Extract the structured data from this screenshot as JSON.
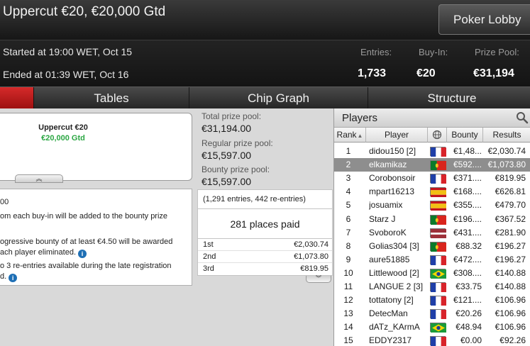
{
  "title": "Uppercut €20, €20,000 Gtd",
  "lobby_button": "Poker Lobby",
  "started": "Started at 19:00 WET, Oct 15",
  "ended": "Ended at 01:39 WET, Oct 16",
  "stats": {
    "entries_label": "Entries:",
    "entries_value": "1,733",
    "buyin_label": "Buy-In:",
    "buyin_value": "€20",
    "prizepool_label": "Prize Pool:",
    "prizepool_value": "€31,194"
  },
  "tabs": [
    "Tables",
    "Chip Graph",
    "Structure"
  ],
  "card": {
    "name": "Uppercut €20",
    "gtd": "€20,000 Gtd",
    "collapse": "︽"
  },
  "description": [
    "00",
    "om each buy-in will be added to the bounty prize",
    "",
    "ogressive bounty of at least €4.50 will be awarded",
    "ach player eliminated.",
    "o 3 re-entries available during the late registration",
    "d."
  ],
  "prize": {
    "total_label": "Total prize pool:",
    "total_value": "€31,194.00",
    "regular_label": "Regular prize pool:",
    "regular_value": "€15,597.00",
    "bounty_label": "Bounty prize pool:",
    "bounty_value": "€15,597.00",
    "entries_note": "(1,291 entries, 442 re-entries)",
    "places_paid": "281 places paid",
    "rows": [
      {
        "place": "1st",
        "amount": "€2,030.74"
      },
      {
        "place": "2nd",
        "amount": "€1,073.80"
      },
      {
        "place": "3rd",
        "amount": "€819.95"
      }
    ],
    "expand": "︾"
  },
  "players": {
    "title": "Players",
    "columns": {
      "rank": "Rank",
      "player": "Player",
      "bounty": "Bounty",
      "results": "Results"
    },
    "rows": [
      {
        "rank": "1",
        "name": "didou150 [2]",
        "flag": "france",
        "bounty": "€1,48...",
        "result": "€2,030.74",
        "selected": false
      },
      {
        "rank": "2",
        "name": "elkamikaz",
        "flag": "portugal",
        "bounty": "€592....",
        "result": "€1,073.80",
        "selected": true
      },
      {
        "rank": "3",
        "name": "Corobonsoir",
        "flag": "france",
        "bounty": "€371....",
        "result": "€819.95",
        "selected": false
      },
      {
        "rank": "4",
        "name": "mpart16213",
        "flag": "spain",
        "bounty": "€168....",
        "result": "€626.81",
        "selected": false
      },
      {
        "rank": "5",
        "name": "josuamix",
        "flag": "spain",
        "bounty": "€355....",
        "result": "€479.70",
        "selected": false
      },
      {
        "rank": "6",
        "name": "Starz J",
        "flag": "portugal",
        "bounty": "€196....",
        "result": "€367.52",
        "selected": false
      },
      {
        "rank": "7",
        "name": "SvoboroK",
        "flag": "latvia",
        "bounty": "€431....",
        "result": "€281.90",
        "selected": false
      },
      {
        "rank": "8",
        "name": "Golias304 [3]",
        "flag": "portugal",
        "bounty": "€88.32",
        "result": "€196.27",
        "selected": false
      },
      {
        "rank": "9",
        "name": "aure51885",
        "flag": "france",
        "bounty": "€472....",
        "result": "€196.27",
        "selected": false
      },
      {
        "rank": "10",
        "name": "Littlewood [2]",
        "flag": "brazil",
        "bounty": "€308....",
        "result": "€140.88",
        "selected": false
      },
      {
        "rank": "11",
        "name": "LANGUE 2 [3]",
        "flag": "france",
        "bounty": "€33.75",
        "result": "€140.88",
        "selected": false
      },
      {
        "rank": "12",
        "name": "tottatony [2]",
        "flag": "france",
        "bounty": "€121....",
        "result": "€106.96",
        "selected": false
      },
      {
        "rank": "13",
        "name": "DetecMan",
        "flag": "france",
        "bounty": "€20.26",
        "result": "€106.96",
        "selected": false
      },
      {
        "rank": "14",
        "name": "dATz_KArmA",
        "flag": "brazil",
        "bounty": "€48.94",
        "result": "€106.96",
        "selected": false
      },
      {
        "rank": "15",
        "name": "EDDY2317",
        "flag": "france",
        "bounty": "€0.00",
        "result": "€92.26",
        "selected": false
      }
    ]
  }
}
